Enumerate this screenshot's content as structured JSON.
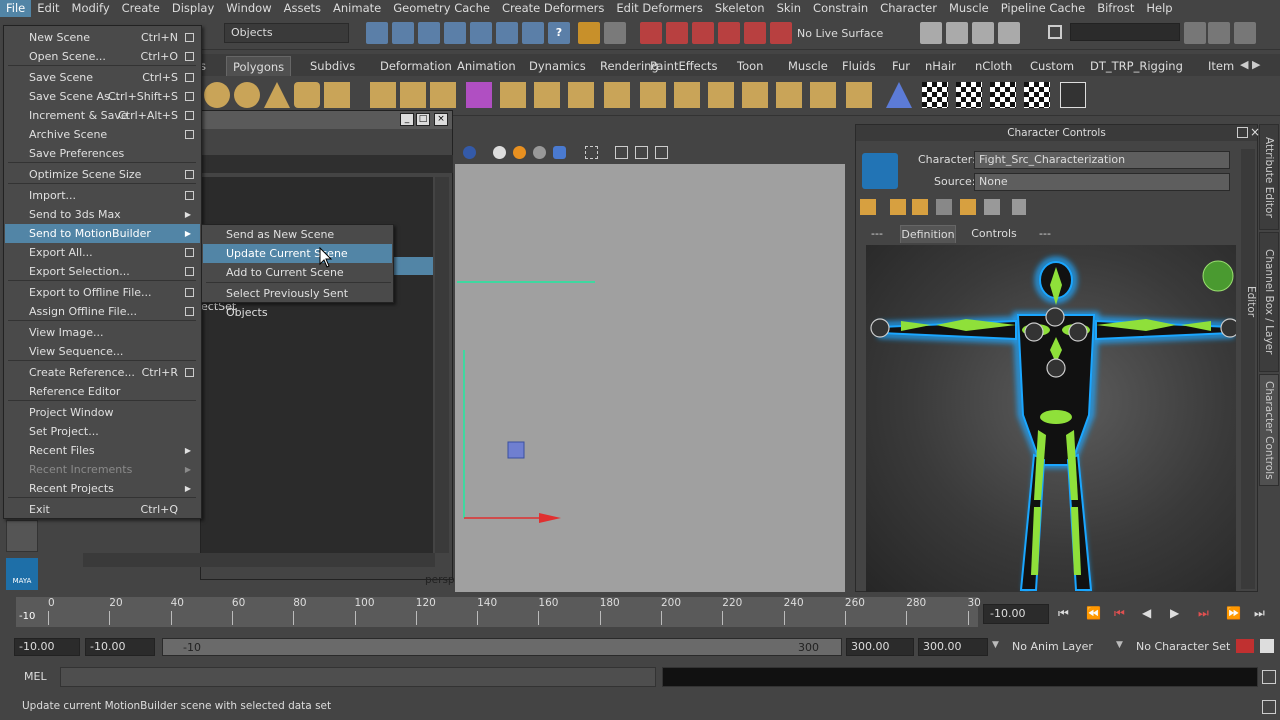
{
  "menubar": {
    "items": [
      "File",
      "Edit",
      "Modify",
      "Create",
      "Display",
      "Window",
      "Assets",
      "Animate",
      "Geometry Cache",
      "Create Deformers",
      "Edit Deformers",
      "Skeleton",
      "Skin",
      "Constrain",
      "Character",
      "Muscle",
      "Pipeline Cache",
      "Bifrost",
      "Help"
    ]
  },
  "statusline": {
    "selection_mode": "Objects",
    "live_surface": "No Live Surface"
  },
  "shelf": {
    "tabs": [
      "s",
      "Polygons",
      "Subdivs",
      "Deformation",
      "Animation",
      "Dynamics",
      "Rendering",
      "PaintEffects",
      "Toon",
      "Muscle",
      "Fluids",
      "Fur",
      "nHair",
      "nCloth",
      "Custom",
      "DT_TRP_Rigging",
      "Item"
    ],
    "active_tab": "Polygons"
  },
  "outliner": {
    "partial_item": "ectSet"
  },
  "viewport": {
    "camera_label": "persp"
  },
  "file_menu": {
    "items": [
      {
        "label": "New Scene",
        "shortcut": "Ctrl+N",
        "option": true
      },
      {
        "label": "Open Scene...",
        "shortcut": "Ctrl+O",
        "option": true
      },
      {
        "label": "Save Scene",
        "shortcut": "Ctrl+S",
        "option": true
      },
      {
        "label": "Save Scene As...",
        "shortcut": "Ctrl+Shift+S",
        "option": true
      },
      {
        "label": "Increment & Save",
        "shortcut": "Ctrl+Alt+S",
        "option": true
      },
      {
        "label": "Archive Scene",
        "shortcut": "",
        "option": true
      },
      {
        "label": "Save Preferences",
        "shortcut": "",
        "option": false
      },
      {
        "label": "Optimize Scene Size",
        "shortcut": "",
        "option": true
      },
      {
        "label": "Import...",
        "shortcut": "",
        "option": true
      },
      {
        "label": "Send to 3ds Max",
        "shortcut": "",
        "submenu": true
      },
      {
        "label": "Send to MotionBuilder",
        "shortcut": "",
        "submenu": true
      },
      {
        "label": "Export All...",
        "shortcut": "",
        "option": true
      },
      {
        "label": "Export Selection...",
        "shortcut": "",
        "option": true
      },
      {
        "label": "Export to Offline File...",
        "shortcut": "",
        "option": true
      },
      {
        "label": "Assign Offline File...",
        "shortcut": "",
        "option": true
      },
      {
        "label": "View Image...",
        "shortcut": ""
      },
      {
        "label": "View Sequence...",
        "shortcut": ""
      },
      {
        "label": "Create Reference...",
        "shortcut": "Ctrl+R",
        "option": true
      },
      {
        "label": "Reference Editor",
        "shortcut": ""
      },
      {
        "label": "Project Window",
        "shortcut": ""
      },
      {
        "label": "Set Project...",
        "shortcut": ""
      },
      {
        "label": "Recent Files",
        "shortcut": "",
        "submenu": true
      },
      {
        "label": "Recent Increments",
        "shortcut": "",
        "submenu": true
      },
      {
        "label": "Recent Projects",
        "shortcut": "",
        "submenu": true
      },
      {
        "label": "Exit",
        "shortcut": "Ctrl+Q"
      }
    ]
  },
  "submenu": {
    "items": [
      "Send as New Scene",
      "Update Current Scene",
      "Add to Current Scene",
      "Select Previously Sent Objects"
    ]
  },
  "character_controls": {
    "title": "Character Controls",
    "character_label": "Character:",
    "character_value": "Fight_Src_Characterization",
    "source_label": "Source:",
    "source_value": "None",
    "tabs": [
      "---",
      "Definition",
      "Controls",
      "---"
    ]
  },
  "side_tabs": [
    "Attribute Editor",
    "Channel Box / Layer Editor",
    "Character Controls"
  ],
  "time_slider": {
    "ticks": [
      "0",
      "20",
      "40",
      "60",
      "80",
      "100",
      "120",
      "140",
      "160",
      "180",
      "200",
      "220",
      "240",
      "260",
      "280",
      "30"
    ],
    "current_marker": "-10",
    "current_time": "-10.00"
  },
  "range": {
    "start_a": "-10.00",
    "start_b": "-10.00",
    "range_start_label": "-10",
    "range_end_label": "300",
    "end_a": "300.00",
    "end_b": "300.00",
    "anim_layer": "No Anim Layer",
    "character_set": "No Character Set"
  },
  "command_line": {
    "language": "MEL"
  },
  "help_line": {
    "text": "Update current MotionBuilder scene with selected data set"
  },
  "colors": {
    "highlight": "#5285a6",
    "rig_green": "#8fe03a",
    "rig_blue": "#1aa6ff"
  }
}
